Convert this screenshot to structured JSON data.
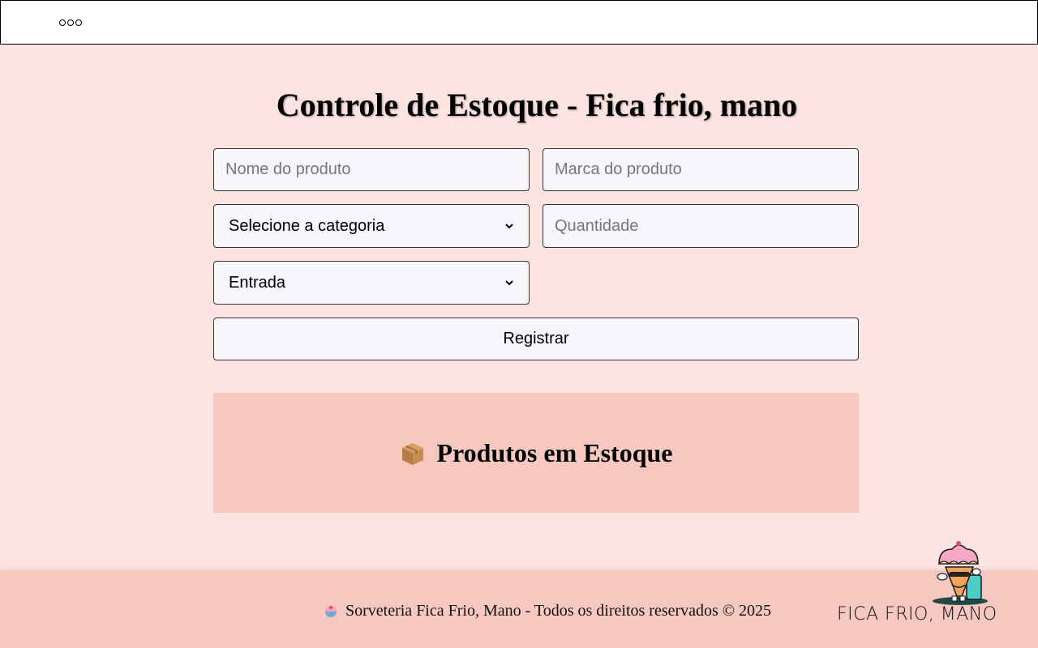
{
  "header": {
    "menu_icon": "more-dots-icon"
  },
  "page": {
    "title": "Controle de Estoque - Fica frio, mano"
  },
  "form": {
    "product_name_placeholder": "Nome do produto",
    "brand_placeholder": "Marca do produto",
    "category_selected": "Selecione a categoria",
    "quantity_placeholder": "Quantidade",
    "movement_selected": "Entrada",
    "submit_label": "Registrar"
  },
  "stock": {
    "icon": "package-icon",
    "title": "Produtos em Estoque"
  },
  "footer": {
    "icon": "ice-cream-icon",
    "copyright": "Sorveteria Fica Frio, Mano - Todos os direitos reservados © 2025",
    "brand": "FICA FRIO, MANO"
  },
  "colors": {
    "background": "#fde4e1",
    "panel": "#f7c8c0",
    "field": "#f6f6fb"
  }
}
